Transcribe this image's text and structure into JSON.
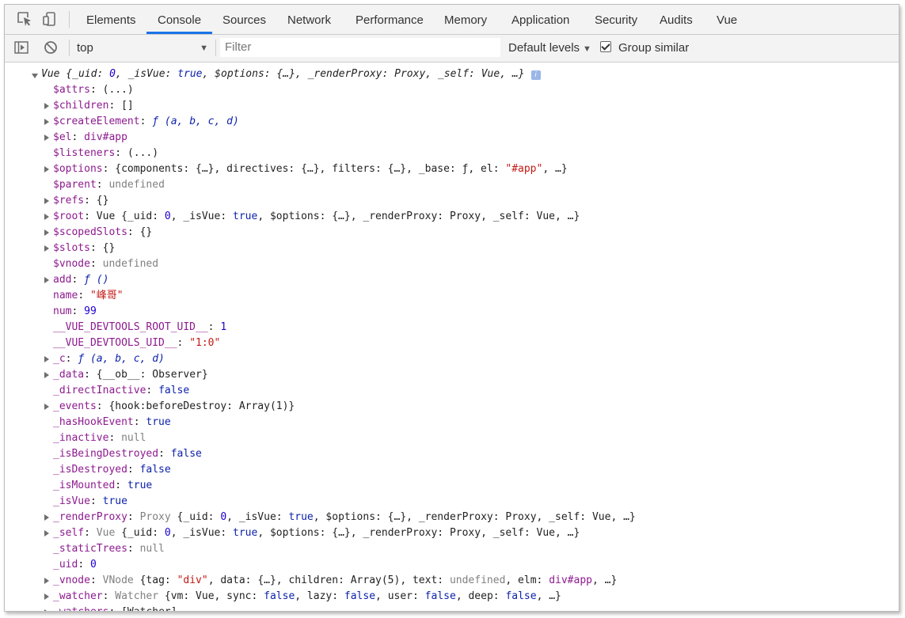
{
  "tabs": [
    {
      "label": "Elements"
    },
    {
      "label": "Console",
      "active": true
    },
    {
      "label": "Sources"
    },
    {
      "label": "Network"
    },
    {
      "label": "Performance"
    },
    {
      "label": "Memory"
    },
    {
      "label": "Application"
    },
    {
      "label": "Security"
    },
    {
      "label": "Audits"
    },
    {
      "label": "Vue"
    }
  ],
  "toolbar": {
    "context": "top",
    "filter_placeholder": "Filter",
    "levels": "Default levels",
    "group_similar": "Group similar",
    "group_similar_checked": true
  },
  "console": {
    "header": [
      [
        "Vue {_uid: ",
        "p"
      ],
      [
        "0",
        "n"
      ],
      [
        ", _isVue: ",
        "p"
      ],
      [
        "true",
        "b"
      ],
      [
        ", $options: {…}, _renderProxy: Proxy, _self: Vue, …}",
        "p"
      ]
    ],
    "rows": [
      {
        "exp": false,
        "key": "$attrs",
        "v": [
          [
            "(...)",
            "p"
          ]
        ]
      },
      {
        "exp": true,
        "key": "$children",
        "v": [
          [
            "[]",
            "p"
          ]
        ]
      },
      {
        "exp": true,
        "key": "$createElement",
        "v": [
          [
            "ƒ (a, b, c, d)",
            "f"
          ]
        ]
      },
      {
        "exp": true,
        "key": "$el",
        "v": [
          [
            "div#app",
            "k"
          ]
        ]
      },
      {
        "exp": false,
        "key": "$listeners",
        "v": [
          [
            "(...)",
            "p"
          ]
        ]
      },
      {
        "exp": true,
        "key": "$options",
        "v": [
          [
            "{components: {…}, directives: {…}, filters: {…}, _base: ƒ, el: ",
            "p"
          ],
          [
            "\"#app\"",
            "s"
          ],
          [
            ", …}",
            "p"
          ]
        ]
      },
      {
        "exp": false,
        "key": "$parent",
        "v": [
          [
            "undefined",
            "g"
          ]
        ]
      },
      {
        "exp": true,
        "key": "$refs",
        "v": [
          [
            "{}",
            "p"
          ]
        ]
      },
      {
        "exp": true,
        "key": "$root",
        "v": [
          [
            "Vue {_uid: ",
            "p"
          ],
          [
            "0",
            "n"
          ],
          [
            ", _isVue: ",
            "p"
          ],
          [
            "true",
            "b"
          ],
          [
            ", $options: {…}, _renderProxy: Proxy, _self: Vue, …}",
            "p"
          ]
        ]
      },
      {
        "exp": true,
        "key": "$scopedSlots",
        "v": [
          [
            "{}",
            "p"
          ]
        ]
      },
      {
        "exp": true,
        "key": "$slots",
        "v": [
          [
            "{}",
            "p"
          ]
        ]
      },
      {
        "exp": false,
        "key": "$vnode",
        "v": [
          [
            "undefined",
            "g"
          ]
        ]
      },
      {
        "exp": true,
        "key": "add",
        "v": [
          [
            "ƒ ()",
            "f"
          ]
        ]
      },
      {
        "exp": false,
        "key": "name",
        "v": [
          [
            "\"峰哥\"",
            "s"
          ]
        ]
      },
      {
        "exp": false,
        "key": "num",
        "v": [
          [
            "99",
            "n"
          ]
        ]
      },
      {
        "exp": false,
        "key": "__VUE_DEVTOOLS_ROOT_UID__",
        "v": [
          [
            "1",
            "n"
          ]
        ]
      },
      {
        "exp": false,
        "key": "__VUE_DEVTOOLS_UID__",
        "v": [
          [
            "\"1:0\"",
            "s"
          ]
        ]
      },
      {
        "exp": true,
        "key": "_c",
        "v": [
          [
            "ƒ (a, b, c, d)",
            "f"
          ]
        ]
      },
      {
        "exp": true,
        "key": "_data",
        "v": [
          [
            "{__ob__: Observer}",
            "p"
          ]
        ]
      },
      {
        "exp": false,
        "key": "_directInactive",
        "v": [
          [
            "false",
            "b"
          ]
        ]
      },
      {
        "exp": true,
        "key": "_events",
        "v": [
          [
            "{hook:beforeDestroy: Array(1)}",
            "p"
          ]
        ]
      },
      {
        "exp": false,
        "key": "_hasHookEvent",
        "v": [
          [
            "true",
            "b"
          ]
        ]
      },
      {
        "exp": false,
        "key": "_inactive",
        "v": [
          [
            "null",
            "g"
          ]
        ]
      },
      {
        "exp": false,
        "key": "_isBeingDestroyed",
        "v": [
          [
            "false",
            "b"
          ]
        ]
      },
      {
        "exp": false,
        "key": "_isDestroyed",
        "v": [
          [
            "false",
            "b"
          ]
        ]
      },
      {
        "exp": false,
        "key": "_isMounted",
        "v": [
          [
            "true",
            "b"
          ]
        ]
      },
      {
        "exp": false,
        "key": "_isVue",
        "v": [
          [
            "true",
            "b"
          ]
        ]
      },
      {
        "exp": true,
        "key": "_renderProxy",
        "v": [
          [
            "Proxy ",
            "g"
          ],
          [
            "{_uid: ",
            "p"
          ],
          [
            "0",
            "n"
          ],
          [
            ", _isVue: ",
            "p"
          ],
          [
            "true",
            "b"
          ],
          [
            ", $options: {…}, _renderProxy: Proxy, _self: Vue, …}",
            "p"
          ]
        ]
      },
      {
        "exp": true,
        "key": "_self",
        "v": [
          [
            "Vue ",
            "g"
          ],
          [
            "{_uid: ",
            "p"
          ],
          [
            "0",
            "n"
          ],
          [
            ", _isVue: ",
            "p"
          ],
          [
            "true",
            "b"
          ],
          [
            ", $options: {…}, _renderProxy: Proxy, _self: Vue, …}",
            "p"
          ]
        ]
      },
      {
        "exp": false,
        "key": "_staticTrees",
        "v": [
          [
            "null",
            "g"
          ]
        ]
      },
      {
        "exp": false,
        "key": "_uid",
        "v": [
          [
            "0",
            "n"
          ]
        ]
      },
      {
        "exp": true,
        "key": "_vnode",
        "v": [
          [
            "VNode ",
            "g"
          ],
          [
            "{tag: ",
            "p"
          ],
          [
            "\"div\"",
            "s"
          ],
          [
            ", data: {…}, children: Array(5), text: ",
            "p"
          ],
          [
            "undefined",
            "g"
          ],
          [
            ", elm: ",
            "p"
          ],
          [
            "div#app",
            "k"
          ],
          [
            ", …}",
            "p"
          ]
        ]
      },
      {
        "exp": true,
        "key": "_watcher",
        "v": [
          [
            "Watcher ",
            "g"
          ],
          [
            "{vm: Vue, sync: ",
            "p"
          ],
          [
            "false",
            "b"
          ],
          [
            ", lazy: ",
            "p"
          ],
          [
            "false",
            "b"
          ],
          [
            ", user: ",
            "p"
          ],
          [
            "false",
            "b"
          ],
          [
            ", deep: ",
            "p"
          ],
          [
            "false",
            "b"
          ],
          [
            ", …}",
            "p"
          ]
        ]
      },
      {
        "exp": true,
        "key": "_watchers",
        "v": [
          [
            "[Watcher]",
            "p"
          ]
        ]
      }
    ]
  }
}
